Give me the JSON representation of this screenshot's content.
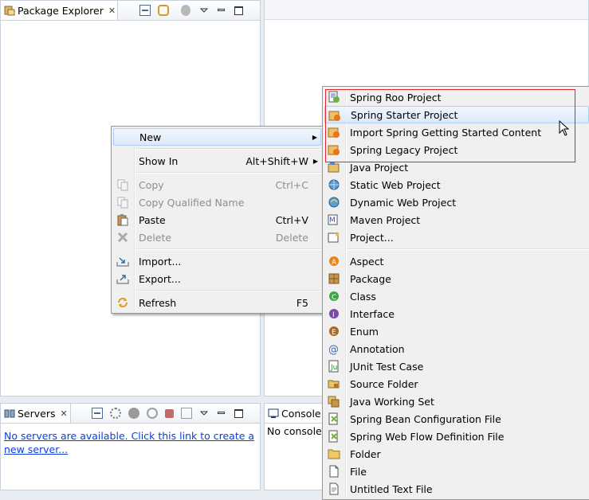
{
  "package_explorer": {
    "title": "Package Explorer",
    "close": "✕"
  },
  "servers": {
    "title": "Servers",
    "close": "✕",
    "link_line1": "No servers are available. Click this link to create a",
    "link_line2": "new server..."
  },
  "console": {
    "title": "Console",
    "body": "No consoles"
  },
  "context_menu": {
    "new": {
      "label": "New",
      "arrow": "▶"
    },
    "show_in": {
      "label": "Show In",
      "accel": "Alt+Shift+W",
      "arrow": "▶"
    },
    "copy": {
      "label": "Copy",
      "accel": "Ctrl+C"
    },
    "copy_qualified": {
      "label": "Copy Qualified Name"
    },
    "paste": {
      "label": "Paste",
      "accel": "Ctrl+V"
    },
    "delete": {
      "label": "Delete",
      "accel": "Delete"
    },
    "import": {
      "label": "Import..."
    },
    "export": {
      "label": "Export..."
    },
    "refresh": {
      "label": "Refresh",
      "accel": "F5"
    }
  },
  "new_submenu": {
    "items": [
      "Spring Roo Project",
      "Spring Starter Project",
      "Import Spring Getting Started Content",
      "Spring Legacy Project",
      "Java Project",
      "Static Web Project",
      "Dynamic Web Project",
      "Maven Project",
      "Project...",
      "Aspect",
      "Package",
      "Class",
      "Interface",
      "Enum",
      "Annotation",
      "JUnit Test Case",
      "Source Folder",
      "Java Working Set",
      "Spring Bean Configuration File",
      "Spring Web Flow Definition File",
      "Folder",
      "File",
      "Untitled Text File"
    ]
  },
  "colors": {
    "highlight_box": "#e0262a",
    "link": "#0b3fd6",
    "menu_bg": "#f0f0f0"
  }
}
